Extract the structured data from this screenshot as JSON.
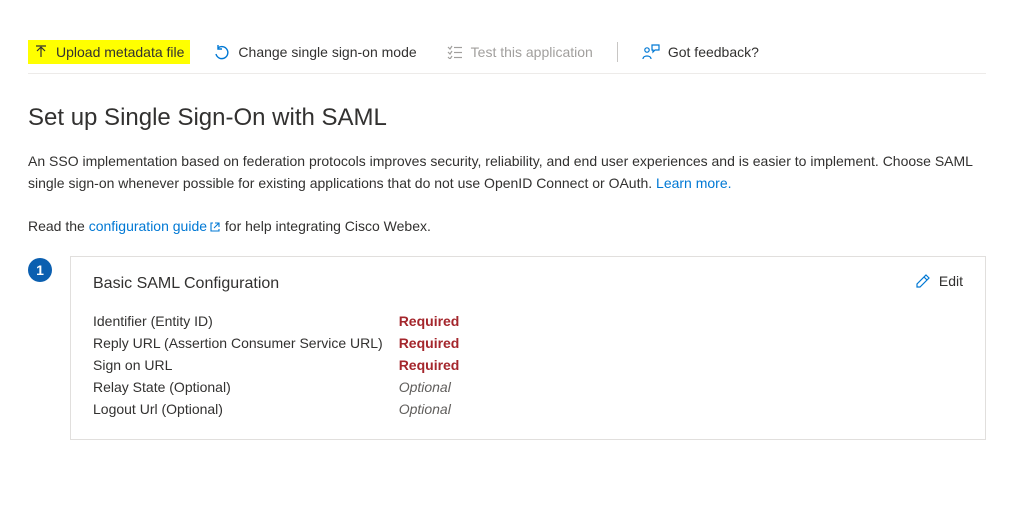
{
  "toolbar": {
    "upload_label": "Upload metadata file",
    "change_label": "Change single sign-on mode",
    "test_label": "Test this application",
    "feedback_label": "Got feedback?"
  },
  "page": {
    "title": "Set up Single Sign-On with SAML",
    "description_pre": "An SSO implementation based on federation protocols improves security, reliability, and end user experiences and is easier to implement. Choose SAML single sign-on whenever possible for existing applications that do not use OpenID Connect or OAuth. ",
    "learn_more": "Learn more.",
    "guide_pre": "Read the ",
    "guide_link": "configuration guide",
    "guide_post": " for help integrating Cisco Webex."
  },
  "step1": {
    "number": "1",
    "title": "Basic SAML Configuration",
    "edit_label": "Edit",
    "fields": [
      {
        "label": "Identifier (Entity ID)",
        "value": "Required",
        "kind": "required"
      },
      {
        "label": "Reply URL (Assertion Consumer Service URL)",
        "value": "Required",
        "kind": "required"
      },
      {
        "label": "Sign on URL",
        "value": "Required",
        "kind": "required"
      },
      {
        "label": "Relay State (Optional)",
        "value": "Optional",
        "kind": "optional"
      },
      {
        "label": "Logout Url (Optional)",
        "value": "Optional",
        "kind": "optional"
      }
    ]
  },
  "colors": {
    "link": "#0078d4",
    "badge": "#0b5fb0",
    "required": "#a4262c",
    "highlight": "#ffff00"
  }
}
